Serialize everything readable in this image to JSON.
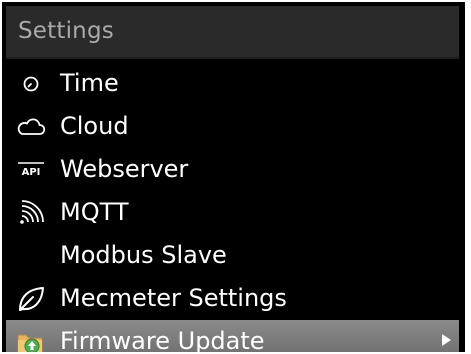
{
  "header": {
    "title": "Settings"
  },
  "menu": {
    "items": [
      {
        "label": "Time",
        "icon": "clock-icon"
      },
      {
        "label": "Cloud",
        "icon": "cloud-icon"
      },
      {
        "label": "Webserver",
        "icon": "api-icon",
        "icon_text": "API"
      },
      {
        "label": "MQTT",
        "icon": "signal-icon"
      },
      {
        "label": "Modbus Slave",
        "icon": ""
      },
      {
        "label": "Mecmeter Settings",
        "icon": "leaf-icon"
      },
      {
        "label": "Firmware Update",
        "icon": "folder-upload-icon",
        "selected": true
      }
    ]
  },
  "colors": {
    "background": "#000000",
    "titlebar": "#2a2a2a",
    "title_text": "#a9a9a9",
    "item_text": "#ffffff",
    "selected_bg": "#7c7c7c",
    "folder": "#e6b35a",
    "upload_arrow": "#4caf50"
  }
}
